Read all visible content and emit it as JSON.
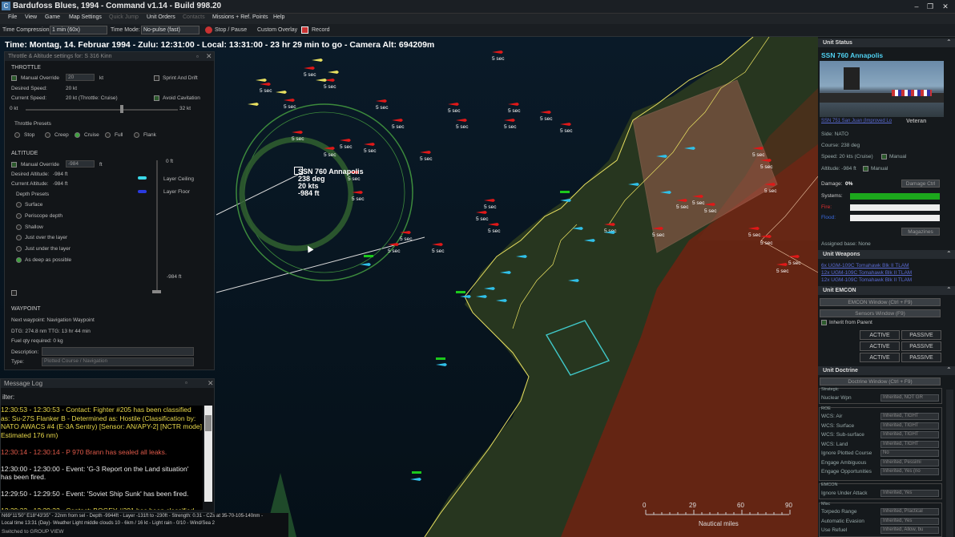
{
  "window": {
    "title": "Bardufoss Blues, 1994 - Command v1.14 - Build 998.20",
    "min": "–",
    "restore": "❐",
    "close": "✕"
  },
  "menu": [
    {
      "label": "File",
      "d": false
    },
    {
      "label": "View",
      "d": false
    },
    {
      "label": "Game",
      "d": false
    },
    {
      "label": "Map Settings",
      "d": false
    },
    {
      "label": "Quick Jump",
      "d": true
    },
    {
      "label": "Unit Orders",
      "d": false
    },
    {
      "label": "Contacts",
      "d": true
    },
    {
      "label": "Missions + Ref. Points",
      "d": false
    },
    {
      "label": "Help",
      "d": false
    }
  ],
  "toolbar": {
    "tc_label": "Time Compression:",
    "tc_value": "1 min (60x)",
    "tm_label": "Time Mode:",
    "tm_value": "No-pulse (fast)",
    "stop": "Stop / Pause",
    "overlay": "Custom Overlay",
    "record": "Record"
  },
  "timebar": "Time: Montag, 14. Februar 1994 - Zulu: 12:31:00 - Local: 13:31:00 - 23 hr 29 min to go -  Camera Alt: 694209m",
  "throttle": {
    "title": "Throttle & Altitude settings for: S 316 Kinn",
    "throttle_h": "THROTTLE",
    "manual": "Manual Override",
    "manual_val": "20",
    "kt": "kt",
    "sprint": "Sprint And Drift",
    "desired": "Desired Speed:",
    "desired_val": "20 kt",
    "current": "Current Speed:",
    "current_val": "20 kt (Throttle: Cruise)",
    "cav": "Avoid Cavitation",
    "min": "0 kt",
    "max": "32 kt",
    "presets_h": "Throttle Presets",
    "presets": [
      "Stop",
      "Creep",
      "Cruise",
      "Full",
      "Flank"
    ],
    "alt_h": "ALTITUDE",
    "alt_manual": "Manual Override",
    "alt_val": "-984",
    "ft": "ft",
    "zero": "0 ft",
    "d_alt": "Desired Altitude:",
    "d_alt_val": "-984 ft",
    "c_alt": "Current Altitude:",
    "c_alt_val": "-984 ft",
    "ceiling": "Layer Ceiling",
    "floor": "Layer Floor",
    "depth_h": "Depth Presets",
    "depths": [
      "Surface",
      "Periscope depth",
      "Shallow",
      "Just over the layer",
      "Just under the layer",
      "As deep as possible"
    ],
    "bottom": "-984 ft",
    "wp_h": "WAYPOINT",
    "wp_next": "Next waypoint: Navigation Waypoint",
    "dtg": "DTG: 274.8 nm   TTG: 13 hr 44 min",
    "fuel": "Fuel qty required: 0 kg",
    "desc": "Description:",
    "type": "Type:",
    "type_val": "Plotted Course / Navigation"
  },
  "log": {
    "title": "Message Log",
    "filter": "ilter:",
    "lines": [
      {
        "t": "12:30:53 - 12:30:53 - Contact: Fighter #205 has been classified",
        "c": "#e8d84a"
      },
      {
        "t": "as: Su-27S Flanker B - Determined as: Hostile (Classification by:",
        "c": "#e8d84a"
      },
      {
        "t": "NATO AWACS #4 (E-3A Sentry) [Sensor: AN/APY-2] [NCTR mode]",
        "c": "#e8d84a"
      },
      {
        "t": "Estimated 176 nm)",
        "c": "#e8d84a"
      },
      {
        "t": "",
        "c": "#fff"
      },
      {
        "t": "12:30:14 - 12:30:14 - P 970 Brann has sealed all leaks.",
        "c": "#e05a4a"
      },
      {
        "t": "",
        "c": "#fff"
      },
      {
        "t": "12:30:00 - 12:30:00 - Event: 'G-3 Report on the Land situation'",
        "c": "#e8e8e8"
      },
      {
        "t": "has been fired.",
        "c": "#e8e8e8"
      },
      {
        "t": "",
        "c": "#fff"
      },
      {
        "t": "12:29:50 - 12:29:50 - Event: 'Soviet Ship Sunk' has been fired.",
        "c": "#e8e8e8"
      },
      {
        "t": "",
        "c": "#fff"
      },
      {
        "t": "12:29:32 - 12:29:32 - Contact: BOGEY #391 has been classified",
        "c": "#e8d84a"
      }
    ]
  },
  "status": {
    "line1": "N69°11'50\" E18°43'35\" - 22nm from sel - Depth -9944ft - Layer -131ft to -230ft - Strength: 0.31 - CZs at 35-70-105-140nm -",
    "line2": "Local time 13:31 (Day)- Weather Light middle clouds 10 - 6km / 16 kt - Light rain - 0/10 - Wind/Sea 2",
    "line3": "Switched to GROUP VIEW"
  },
  "map": {
    "unit_label": [
      "SSN 760 Annapolis",
      "238 deg",
      "20 kts",
      "-984 ft"
    ],
    "sec": "5 sec",
    "scale": {
      "ticks": [
        "0",
        "29",
        "60",
        "90"
      ],
      "label": "Nautical miles"
    },
    "colors": {
      "hostile": "#e01818",
      "friendly": "#30c0e8",
      "coast": "#e8e060",
      "range": "#3c8a3c"
    }
  },
  "unit_status": {
    "h": "Unit Status",
    "name": "SSN 760 Annapolis",
    "class": "SSN 751 San Juan (Improved Lo",
    "rank": "Veteran",
    "side": "Side: NATO",
    "course": "Course: 238 deg",
    "speed": "Speed: 20 kts (Cruise)",
    "manual": "Manual",
    "alt": "Altitude: -984 ft",
    "dmg": "Damage:",
    "dmg_val": "0%",
    "dmg_btn": "Damage Ctrl",
    "systems": "Systems:",
    "fire": "Fire:",
    "flood": "Flood:",
    "mags": "Magazines",
    "base": "Assigned base: None"
  },
  "weapons": {
    "h": "Unit Weapons",
    "items": [
      "6x UGM-109C Tomahawk Blk II TLAM",
      "12x UGM-109C Tomahawk Blk II TLAM",
      "12x UGM-109C Tomahawk Blk II TLAM"
    ]
  },
  "emcon": {
    "h": "Unit EMCON",
    "win": "EMCON Window (Ctrl + F9)",
    "sensors": "Sensors Window (F9)",
    "inherit": "Inherit from Parent",
    "rows": [
      [
        "ACTIVE",
        "PASSIVE"
      ],
      [
        "ACTIVE",
        "PASSIVE"
      ],
      [
        "ACTIVE",
        "PASSIVE"
      ]
    ]
  },
  "doctrine": {
    "h": "Unit Doctrine",
    "win": "Doctrine Window (Ctrl + F9)",
    "g1": "Strategic",
    "nuc": "Nuclear Wpn",
    "nuc_v": "Inherited, NOT GR",
    "g2": "ROE",
    "rows": [
      [
        "WCS: Air",
        "Inherited, TIGHT"
      ],
      [
        "WCS: Surface",
        "Inherited, TIGHT"
      ],
      [
        "WCS: Sub-surface",
        "Inherited, TIGHT"
      ],
      [
        "WCS: Land",
        "Inherited, TIGHT"
      ],
      [
        "Ignore Plotted Course",
        "No"
      ],
      [
        "Engage Ambiguous",
        "Inherited, Pessimi"
      ],
      [
        "Engage Opportunities",
        "Inherited, Yes (no"
      ]
    ],
    "g3": "EMCON",
    "ignore": "Ignore Under Attack",
    "ignore_v": "Inherited, Yes",
    "g4": "Misc",
    "misc": [
      [
        "Torpedo Range",
        "Inherited, Practical"
      ],
      [
        "Automatic Evasion",
        "Inherited, Yes"
      ],
      [
        "Use Refuel",
        "Inherited, Allow, bu"
      ]
    ]
  }
}
